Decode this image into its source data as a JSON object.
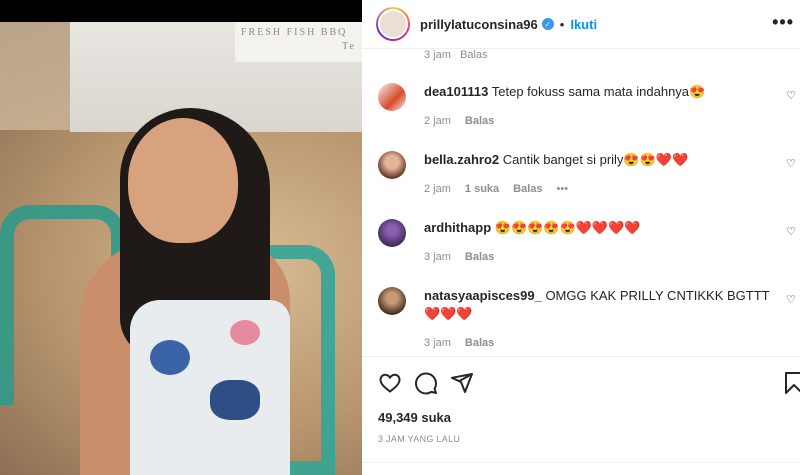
{
  "header": {
    "username": "prillylatuconsina96",
    "separator": "•",
    "follow_label": "Ikuti",
    "more_label": "•••"
  },
  "top_comment_meta": "3 jam   Balas",
  "photo": {
    "sign_text": "FRESH FISH BBQ",
    "sign_text2": "Te"
  },
  "comments": [
    {
      "user": "dea101113",
      "text": "Tetep fokuss sama mata indahnya😍",
      "time": "2 jam",
      "likes": "",
      "reply": "Balas",
      "more": ""
    },
    {
      "user": "bella.zahro2",
      "text": "Cantik banget si prily😍😍❤️❤️",
      "time": "2 jam",
      "likes": "1 suka",
      "reply": "Balas",
      "more": "•••"
    },
    {
      "user": "ardhithapp",
      "text": "😍😍😍😍😍❤️❤️❤️❤️",
      "time": "3 jam",
      "likes": "",
      "reply": "Balas",
      "more": ""
    },
    {
      "user": "natasyaapisces99_",
      "text": "OMGG KAK PRILLY CNTIKKK BGTTT❤️❤️❤️",
      "time": "3 jam",
      "likes": "",
      "reply": "Balas",
      "more": ""
    }
  ],
  "likes": "49,349 suka",
  "posted": "3 JAM YANG LALU",
  "colors": {
    "link": "#0095f6",
    "muted": "#8e8e8e",
    "text": "#262626",
    "verified": "#3897f0"
  },
  "icons": [
    "heart-icon",
    "comment-icon",
    "share-icon",
    "bookmark-icon",
    "more-icon",
    "verified-icon"
  ]
}
